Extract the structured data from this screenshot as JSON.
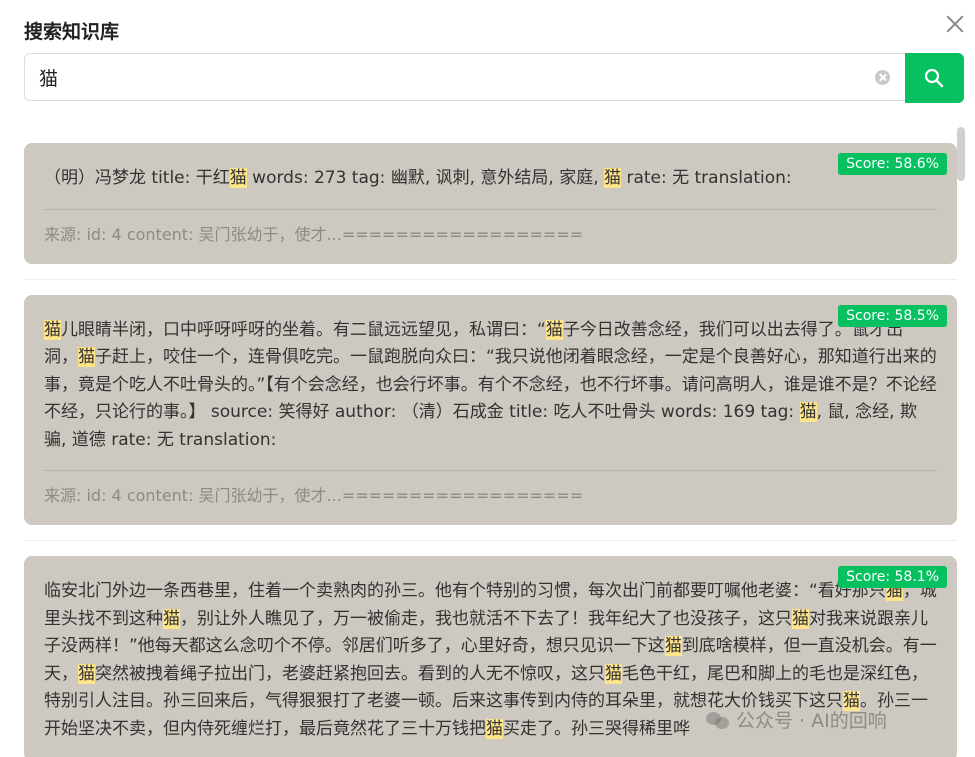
{
  "dialog": {
    "title": "搜索知识库"
  },
  "search": {
    "value": "猫",
    "placeholder": ""
  },
  "results": [
    {
      "score": "Score: 58.6%",
      "segments": [
        {
          "t": "（明）冯梦龙 title: 干红",
          "h": false
        },
        {
          "t": "猫",
          "h": true
        },
        {
          "t": " words: 273 tag: 幽默, 讽刺, 意外结局, 家庭, ",
          "h": false
        },
        {
          "t": "猫",
          "h": true
        },
        {
          "t": " rate: 无 translation:",
          "h": false
        }
      ],
      "source": "来源: id: 4 content: 吴门张幼于，使才...=================="
    },
    {
      "score": "Score: 58.5%",
      "segments": [
        {
          "t": "猫",
          "h": true
        },
        {
          "t": "儿眼睛半闭，口中呼呀呼呀的坐着。有二鼠远远望见，私谓曰：“",
          "h": false
        },
        {
          "t": "猫",
          "h": true
        },
        {
          "t": "子今日改善念经，我们可以出去得了。”鼠才出洞，",
          "h": false
        },
        {
          "t": "猫",
          "h": true
        },
        {
          "t": "子赶上，咬住一个，连骨俱吃完。一鼠跑脱向众曰：“我只说他闭着眼念经，一定是个良善好心，那知道行出来的事，竟是个吃人不吐骨头的。”【有个会念经，也会行坏事。有个不念经，也不行坏事。请问高明人，谁是谁不是？不论经不经，只论行的事。】 source: 笑得好 author: （清）石成金 title: 吃人不吐骨头 words: 169 tag: ",
          "h": false
        },
        {
          "t": "猫",
          "h": true
        },
        {
          "t": ", 鼠, 念经, 欺骗, 道德 rate: 无 translation:",
          "h": false
        }
      ],
      "source": "来源: id: 4 content: 吴门张幼于，使才...=================="
    },
    {
      "score": "Score: 58.1%",
      "segments": [
        {
          "t": "临安北门外边一条西巷里，住着一个卖熟肉的孙三。他有个特别的习惯，每次出门前都要叮嘱他老婆：“看好那只",
          "h": false
        },
        {
          "t": "猫",
          "h": true
        },
        {
          "t": "，城里头找不到这种",
          "h": false
        },
        {
          "t": "猫",
          "h": true
        },
        {
          "t": "，别让外人瞧见了，万一被偷走，我也就活不下去了！我年纪大了也没孩子，这只",
          "h": false
        },
        {
          "t": "猫",
          "h": true
        },
        {
          "t": "对我来说跟亲儿子没两样！”他每天都这么念叨个不停。邻居们听多了，心里好奇，想只见识一下这",
          "h": false
        },
        {
          "t": "猫",
          "h": true
        },
        {
          "t": "到底啥模样，但一直没机会。有一天，",
          "h": false
        },
        {
          "t": "猫",
          "h": true
        },
        {
          "t": "突然被拽着绳子拉出门，老婆赶紧抱回去。看到的人无不惊叹，这只",
          "h": false
        },
        {
          "t": "猫",
          "h": true
        },
        {
          "t": "毛色干红，尾巴和脚上的毛也是深红色，特别引人注目。孙三回来后，气得狠狠打了老婆一顿。后来这事传到内侍的耳朵里，就想花大价钱买下这只",
          "h": false
        },
        {
          "t": "猫",
          "h": true
        },
        {
          "t": "。孙三一开始坚决不卖，但内侍死缠烂打，最后竟然花了三十万钱把",
          "h": false
        },
        {
          "t": "猫",
          "h": true
        },
        {
          "t": "买走了。孙三哭得稀里哗",
          "h": false
        }
      ],
      "source": ""
    }
  ],
  "watermark": "公众号 · AI的回响",
  "colors": {
    "accent": "#07c160",
    "highlight": "#ffe58a",
    "card": "#cdc8c0"
  }
}
